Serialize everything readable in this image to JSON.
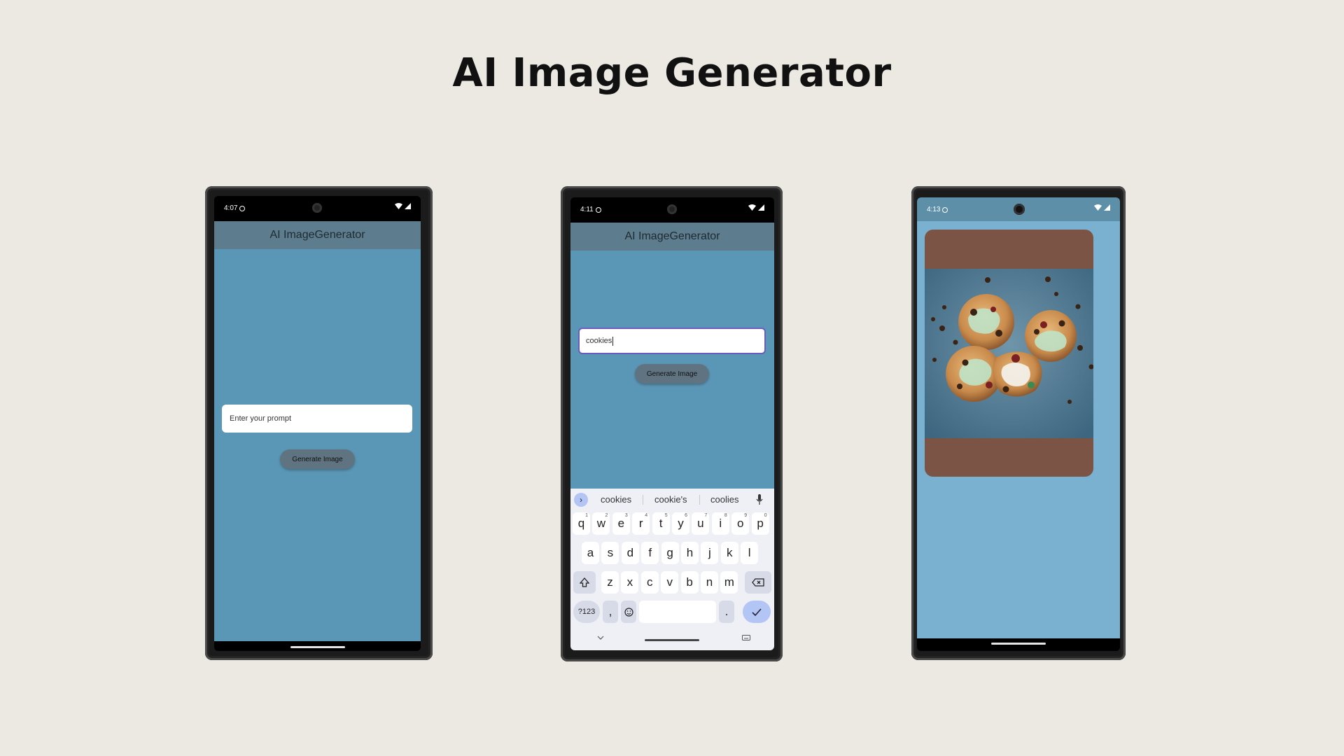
{
  "page": {
    "title": "AI Image Generator"
  },
  "screen1": {
    "time": "4:07",
    "app_title": "AI ImageGenerator",
    "prompt_placeholder": "Enter your prompt",
    "button_label": "Generate Image"
  },
  "screen2": {
    "time": "4:11",
    "app_title": "AI ImageGenerator",
    "prompt_value": "cookies",
    "button_label": "Generate Image",
    "suggestions": [
      "cookies",
      "cookie's",
      "coolies"
    ],
    "row1": [
      "q",
      "w",
      "e",
      "r",
      "t",
      "y",
      "u",
      "i",
      "o",
      "p"
    ],
    "row1_nums": [
      "1",
      "2",
      "3",
      "4",
      "5",
      "6",
      "7",
      "8",
      "9",
      "0"
    ],
    "row2": [
      "a",
      "s",
      "d",
      "f",
      "g",
      "h",
      "j",
      "k",
      "l"
    ],
    "row3": [
      "z",
      "x",
      "c",
      "v",
      "b",
      "n",
      "m"
    ],
    "sym_label": "?123",
    "comma_label": ",",
    "period_label": "."
  },
  "screen3": {
    "time": "4:13",
    "image_subject": "cookies"
  },
  "colors": {
    "background": "#ece8e2",
    "screen_blue": "#5a96b5",
    "app_bar": "#5d7d8e",
    "screen3_blue": "#7ab0d0",
    "image_card": "#7b5446"
  }
}
